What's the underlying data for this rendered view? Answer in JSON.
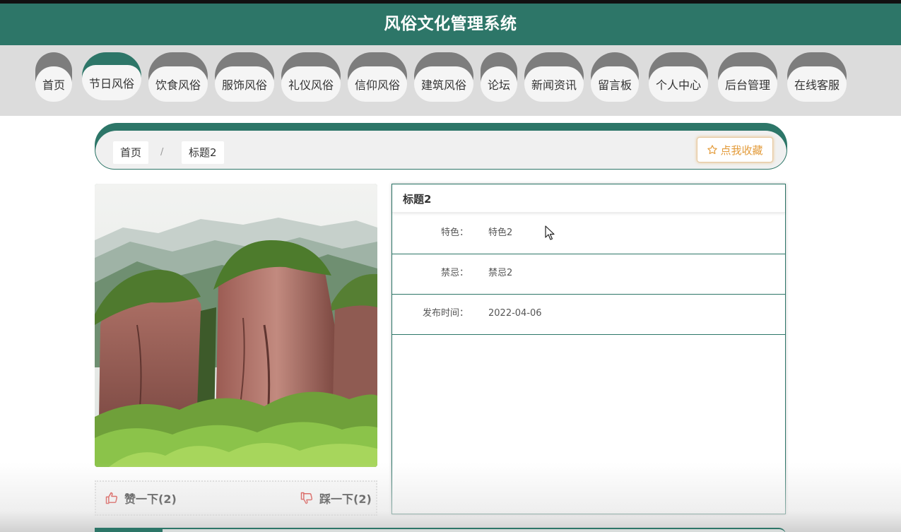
{
  "header": {
    "title": "风俗文化管理系统"
  },
  "nav": {
    "items": [
      {
        "label": "首页",
        "active": false
      },
      {
        "label": "节日风俗",
        "active": true
      },
      {
        "label": "饮食风俗",
        "active": false
      },
      {
        "label": "服饰风俗",
        "active": false
      },
      {
        "label": "礼仪风俗",
        "active": false
      },
      {
        "label": "信仰风俗",
        "active": false
      },
      {
        "label": "建筑风俗",
        "active": false
      },
      {
        "label": "论坛",
        "active": false
      },
      {
        "label": "新闻资讯",
        "active": false
      },
      {
        "label": "留言板",
        "active": false
      },
      {
        "label": "个人中心",
        "active": false
      },
      {
        "label": "后台管理",
        "active": false
      },
      {
        "label": "在线客服",
        "active": false
      }
    ]
  },
  "breadcrumb": {
    "home": "首页",
    "separator": "/",
    "current": "标题2"
  },
  "actions": {
    "collect_label": "点我收藏"
  },
  "detail": {
    "title": "标题2",
    "rows": [
      {
        "label": "特色：",
        "value": "特色2"
      },
      {
        "label": "禁忌：",
        "value": "禁忌2"
      },
      {
        "label": "发布时间：",
        "value": "2022-04-06"
      }
    ]
  },
  "votes": {
    "like_label": "赞一下(2)",
    "dislike_label": "踩一下(2)"
  },
  "theme": {
    "primary": "#2d7668",
    "accent": "#e39b3a",
    "vote_red": "#d9302b"
  },
  "icons": {
    "collect": "star-outline-icon",
    "like": "thumbs-up-icon",
    "dislike": "thumbs-down-icon"
  }
}
